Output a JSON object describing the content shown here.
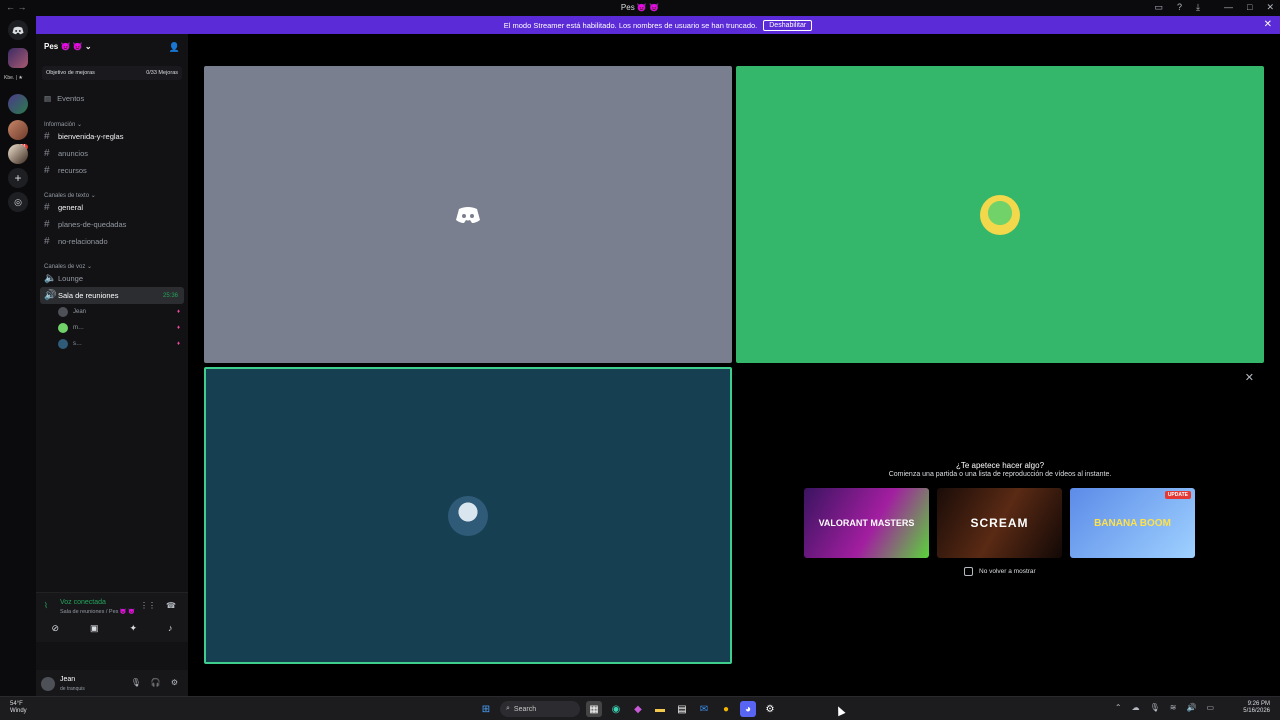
{
  "window": {
    "title": "Pes 👿 👿"
  },
  "banner": {
    "text": "El modo Streamer está habilitado. Los nombres de usuario se han truncado.",
    "button": "Deshabilitar"
  },
  "server": {
    "name": "Pes 👿 👿",
    "boost_label": "Objetivo de mejoras",
    "boost_count": "0/33 Mejoras",
    "events_label": "Eventos",
    "rail_tag": "Kbe. | ★",
    "rail_badge": "24"
  },
  "categories": {
    "info": "Información",
    "text": "Canales de texto",
    "voice": "Canales de voz"
  },
  "channels": {
    "info": [
      "bienvenida-y-reglas",
      "anuncios",
      "recursos"
    ],
    "text": [
      "general",
      "planes-de-quedadas",
      "no-relacionado"
    ],
    "voice": {
      "lounge": "Lounge",
      "room": "Sala de reuniones",
      "timer": "25:36"
    }
  },
  "voice_users": [
    "Jean",
    "m…",
    "s…"
  ],
  "voice_panel": {
    "status": "Voz conectada",
    "location": "Sala de reuniones / Pes 👿 👿"
  },
  "user": {
    "name": "Jean",
    "status": "de tranquis"
  },
  "activity": {
    "question": "¿Te apetece hacer algo?",
    "subtitle": "Comienza una partida o una lista de reproducción de vídeos al instante.",
    "games": [
      "VALORANT MASTERS",
      "SCREAM",
      "BANANA BOOM"
    ],
    "update_badge": "UPDATE",
    "dont_show": "No volver a mostrar"
  },
  "taskbar": {
    "weather_temp": "54°F",
    "weather_desc": "Windy",
    "search": "Search",
    "time": "9:26 PM",
    "date": "5/16/2026"
  },
  "icons": {
    "discord": "discord-icon",
    "add": "plus-icon",
    "explore": "compass-icon",
    "hash": "hash-icon",
    "speaker": "speaker-icon"
  },
  "colors": {
    "banner": "#5b2bd8",
    "green_tile": "#34b66b",
    "gray_tile": "#7a7f8f",
    "teal_tile": "#173f52",
    "speaking_border": "#3ecf8e"
  }
}
